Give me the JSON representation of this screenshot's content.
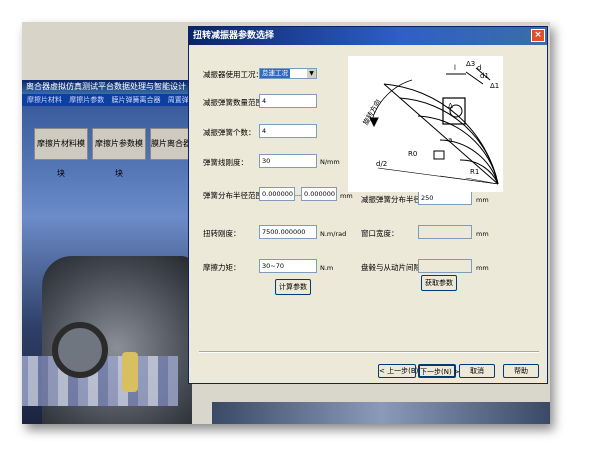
{
  "background_app": {
    "title": "离合器虚拟仿真测试平台数据处理与智能设计",
    "menu": [
      "摩擦片材料",
      "摩擦片参数",
      "膜片弹簧离合器",
      "周置弹簧离合"
    ],
    "buttons": [
      "摩擦片材料模块",
      "摩擦片参数模块",
      "膜片离合器参"
    ]
  },
  "dialog": {
    "title": "扭转减振器参数选择",
    "close_glyph": "×",
    "fields": {
      "usage_condition": {
        "label": "减振器使用工况：",
        "value": "怠速工况"
      },
      "spring_count_range": {
        "label": "减振弹簧数量范围：",
        "value": "4"
      },
      "spring_count": {
        "label": "减振弹簧个数：",
        "value": "4"
      },
      "spring_stiffness": {
        "label": "弹簧线刚度：",
        "value": "30",
        "unit": "N/mm"
      },
      "spring_radius_range": {
        "label": "弹簧分布半径范围：",
        "value_min": "0.000000",
        "separator": "----",
        "value_max": "0.000000",
        "unit": "mm"
      },
      "torsional_stiffness": {
        "label": "扭转刚度：",
        "value": "7500.000000",
        "unit": "N.m/rad"
      },
      "friction_torque": {
        "label": "摩擦力矩：",
        "value": "30~70",
        "unit": "N.m"
      },
      "spring_radius": {
        "label": "减振弹簧分布半径：",
        "value": "250",
        "unit": "mm"
      },
      "window_width": {
        "label": "窗口宽度：",
        "value": "",
        "unit": "mm"
      },
      "disc_gap": {
        "label": "盘毂与从动片间隙：",
        "value": "",
        "unit": "mm"
      }
    },
    "buttons": {
      "compute": "计算参数",
      "get": "获取参数",
      "back": "< 上一步(B)",
      "next": "下一步(N) >",
      "cancel": "取消",
      "help": "帮助"
    },
    "diagram_labels": {
      "l": "l",
      "delta3": "Δ3",
      "d": "d",
      "d1": "d1",
      "delta1": "Δ1",
      "delta": "Δ",
      "rotation": "旋转方向",
      "r0": "R0",
      "d2": "d/2",
      "r1": "R1",
      "a": "a"
    }
  }
}
